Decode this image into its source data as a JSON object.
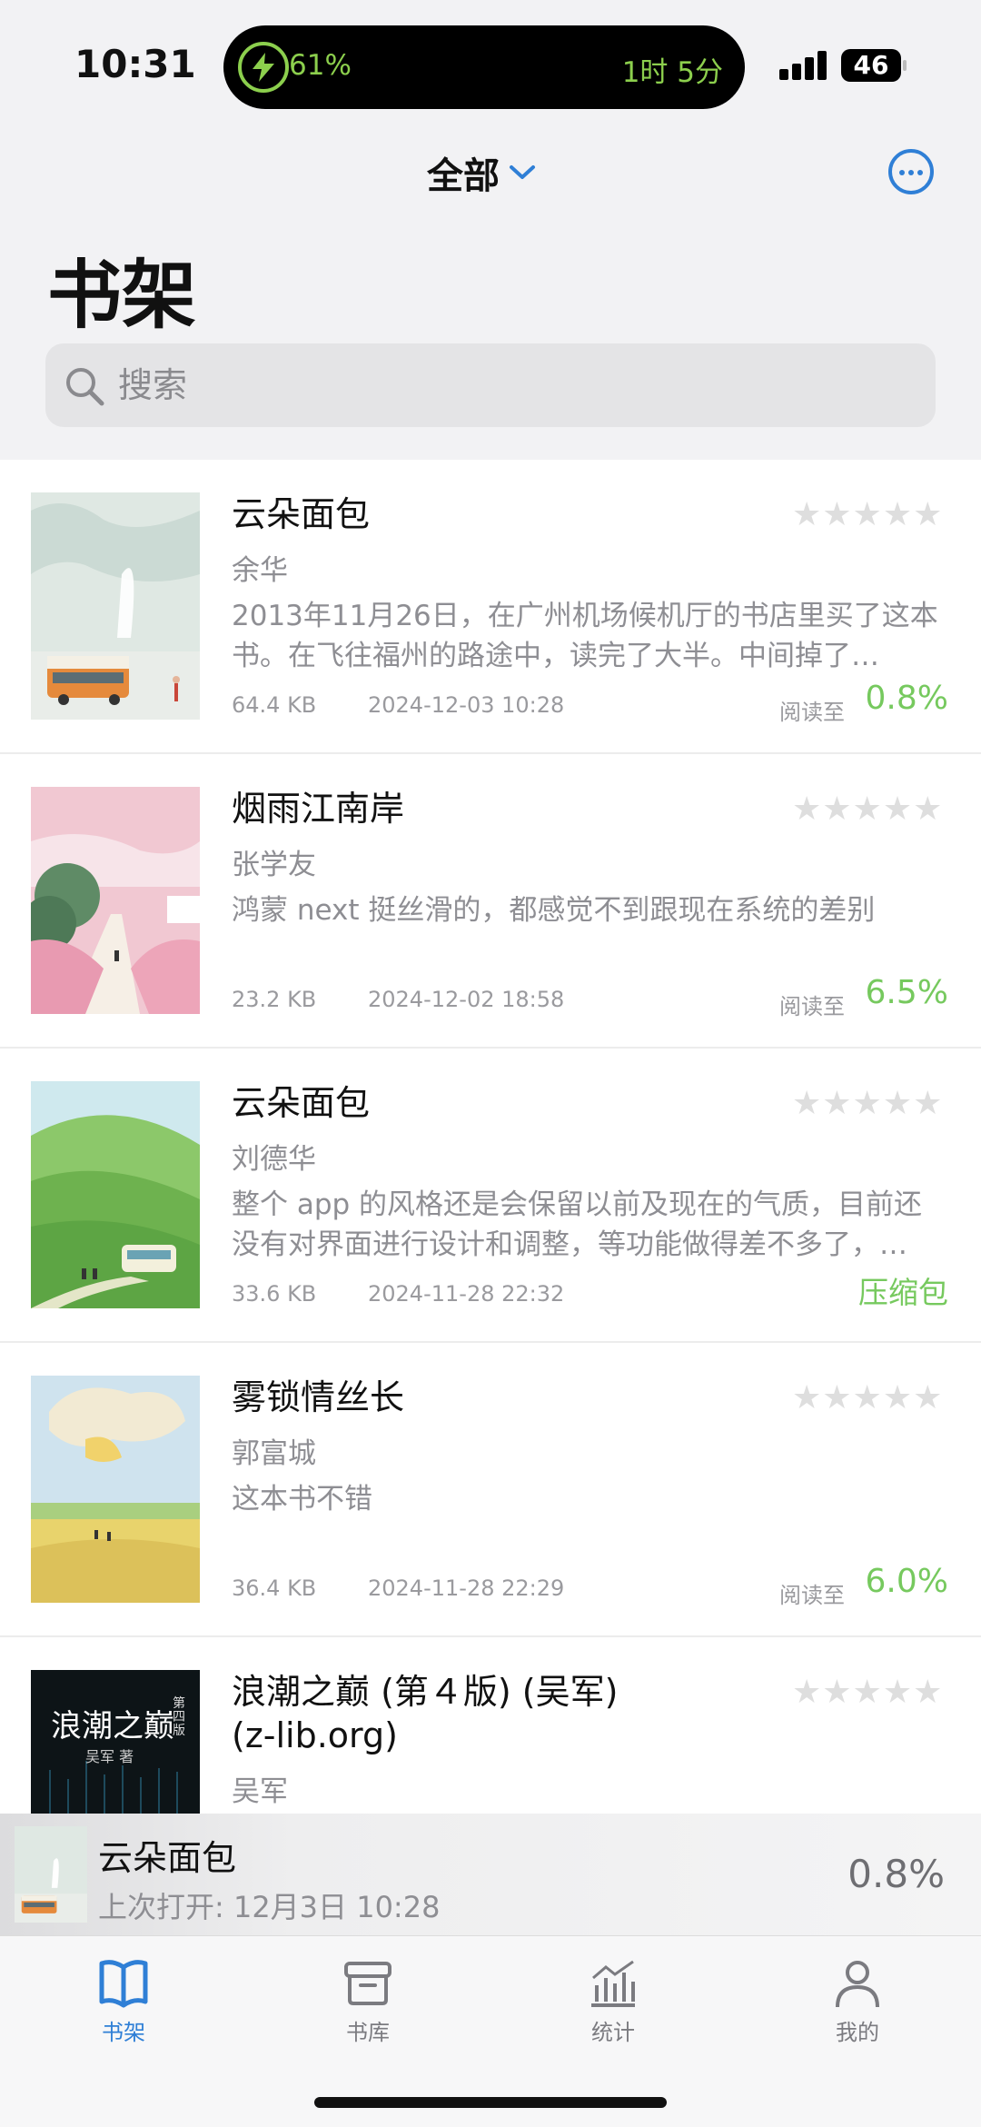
{
  "status": {
    "time": "10:31",
    "battery_pct": "61%",
    "remaining": "1时 5分",
    "battery_level": "46"
  },
  "header": {
    "filter_label": "全部",
    "page_title": "书架"
  },
  "search": {
    "placeholder": "搜索"
  },
  "books": [
    {
      "title": "云朵面包",
      "author": "余华",
      "desc": "2013年11月26日，在广州机场候机厅的书店里买了这本书。在飞往福州的路途中，读完了大半。中间掉了…",
      "size": "64.4 KB",
      "date": "2024-12-03 10:28",
      "read_label": "阅读至",
      "progress": "0.8%",
      "rating": 0
    },
    {
      "title": "烟雨江南岸",
      "author": "张学友",
      "desc": "鸿蒙 next 挺丝滑的，都感觉不到跟现在系统的差别",
      "size": "23.2 KB",
      "date": "2024-12-02 18:58",
      "read_label": "阅读至",
      "progress": "6.5%",
      "rating": 0
    },
    {
      "title": "云朵面包",
      "author": "刘德华",
      "desc": "整个 app 的风格还是会保留以前及现在的气质，目前还没有对界面进行设计和调整，等功能做得差不多了，…",
      "size": "33.6 KB",
      "date": "2024-11-28 22:32",
      "status": "压缩包",
      "rating": 0
    },
    {
      "title": "雾锁情丝长",
      "author": "郭富城",
      "desc": "这本书不错",
      "size": "36.4 KB",
      "date": "2024-11-28 22:29",
      "read_label": "阅读至",
      "progress": "6.0%",
      "rating": 0
    },
    {
      "title": "浪潮之巅 (第４版) (吴军)\n(z-lib.org)",
      "author": "吴军",
      "cover_title": "浪潮之巅",
      "cover_edition": "第四版",
      "cover_author": "吴军 著",
      "rating": 0
    }
  ],
  "stars_glyph": "★★★★★",
  "mini_player": {
    "title": "云朵面包",
    "last_opened": "上次打开: 12月3日 10:28",
    "progress": "0.8%"
  },
  "tabs": [
    {
      "label": "书架",
      "icon": "book-open-icon",
      "active": true
    },
    {
      "label": "书库",
      "icon": "archive-box-icon",
      "active": false
    },
    {
      "label": "统计",
      "icon": "chart-bars-icon",
      "active": false
    },
    {
      "label": "我的",
      "icon": "person-icon",
      "active": false
    }
  ],
  "colors": {
    "accent": "#2f7fd6",
    "progress_green": "#76c95e",
    "battery_green": "#8ccf4d"
  }
}
